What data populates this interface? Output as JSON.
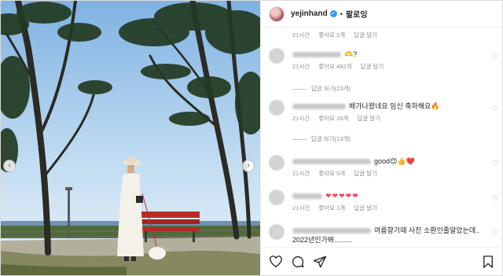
{
  "header": {
    "username": "yejinhand",
    "verified_glyph": "✓",
    "separator": "•",
    "follow_label": "팔로잉"
  },
  "top_meta": {
    "time": "21시간",
    "likes": "좋아요 2개",
    "reply": "답글 달기"
  },
  "comments": [
    {
      "text": "🫶?",
      "time": "21시간",
      "likes": "좋아요 482개",
      "reply": "답글 달기",
      "replies_label": "답글 보기(23개)"
    },
    {
      "text": "배가나왔네요 임신 축하해요🔥",
      "time": "21시간",
      "likes": "좋아요 16개",
      "reply": "답글 달기",
      "replies_label": "답글 보기(13개)"
    },
    {
      "text": "good😊👍❤️",
      "time": "21시간",
      "likes": "좋아요 5개",
      "reply": "답글 달기"
    },
    {
      "text": "❤❤❤❤❤",
      "time": "21시간",
      "likes": "좋아요 1개",
      "reply": "답글 달기"
    },
    {
      "text": "여름향기때 사진 소환인줄알았는데.. 2022년인가봐.........",
      "time": "",
      "likes": "",
      "reply": ""
    }
  ],
  "icons": {
    "like": "heart-outline-icon",
    "comment": "comment-icon",
    "share": "paper-plane-icon",
    "save": "bookmark-icon",
    "comment_like": "small-heart-icon",
    "prev": "chevron-left-icon",
    "next": "chevron-right-icon"
  },
  "colors": {
    "accent_blue": "#3897f0",
    "heart_red": "#ed4956",
    "meta_gray": "#8e8e8e"
  }
}
